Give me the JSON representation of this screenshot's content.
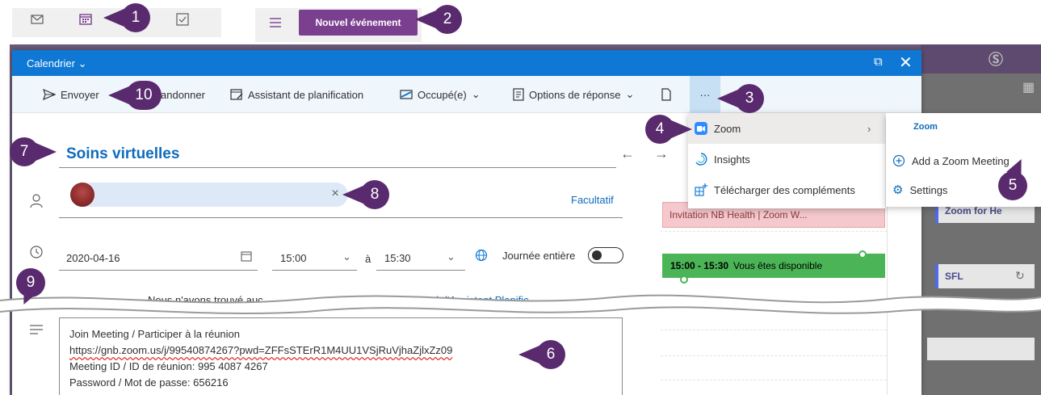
{
  "nav": {
    "mail_icon": "mail-icon",
    "calendar_icon": "calendar-icon",
    "tasks_icon": "checkbox-icon",
    "new_event_label": "Nouvel événement"
  },
  "dialog": {
    "header_title": "Calendrier",
    "toolbar": {
      "send": "Envoyer",
      "discard_partial": "andonner",
      "scheduling_assistant": "Assistant de planification",
      "busy_status": "Occupé(e)",
      "response_options": "Options de réponse",
      "more": "···"
    },
    "title_value": "Soins virtuelles",
    "attendee_remove": "×",
    "optional_label": "Facultatif",
    "date_value": "2020-04-16",
    "start_time": "15:00",
    "to_label": "à",
    "end_time": "15:30",
    "all_day_label": "Journée entière",
    "notice_text": "Nous n'avons trouvé auc",
    "notice_link": "Ouvrir l'Assistant Planific",
    "body_lines": [
      "Join Meeting / Participer à la réunion",
      "https://gnb.zoom.us/j/99540874267?pwd=ZFFsSTErR1M4UU1VSjRuVjhaZjlxZz09",
      "Meeting ID / ID de réunion: 995 4087 4267",
      "Password / Mot de passe: 656216"
    ]
  },
  "schedule": {
    "busy_block_text": "Invitation NB Health | Zoom W...",
    "free_time": "15:00 - 15:30",
    "free_label": "Vous êtes disponible"
  },
  "menu": {
    "items": [
      {
        "label": "Zoom",
        "icon": "zoom-icon"
      },
      {
        "label": "Insights",
        "icon": "insights-icon"
      },
      {
        "label": "Télécharger des compléments",
        "icon": "add-ins-icon"
      }
    ],
    "submenu_title": "Zoom",
    "submenu_items": [
      {
        "label": "Add a Zoom Meeting",
        "icon": "plus-circle-icon"
      },
      {
        "label": "Settings",
        "icon": "gear-icon"
      }
    ]
  },
  "background": {
    "card_zoom": "Zoom for He",
    "card_sfl": "SFL"
  },
  "callouts": [
    "1",
    "2",
    "3",
    "4",
    "5",
    "6",
    "7",
    "8",
    "9",
    "10"
  ],
  "colors": {
    "accent_blue": "#0f78d4",
    "brand_purple": "#7b3f8f",
    "callout_purple": "#5a2a6e",
    "free_green": "#4ab456",
    "busy_pink": "#f4c8cc"
  }
}
